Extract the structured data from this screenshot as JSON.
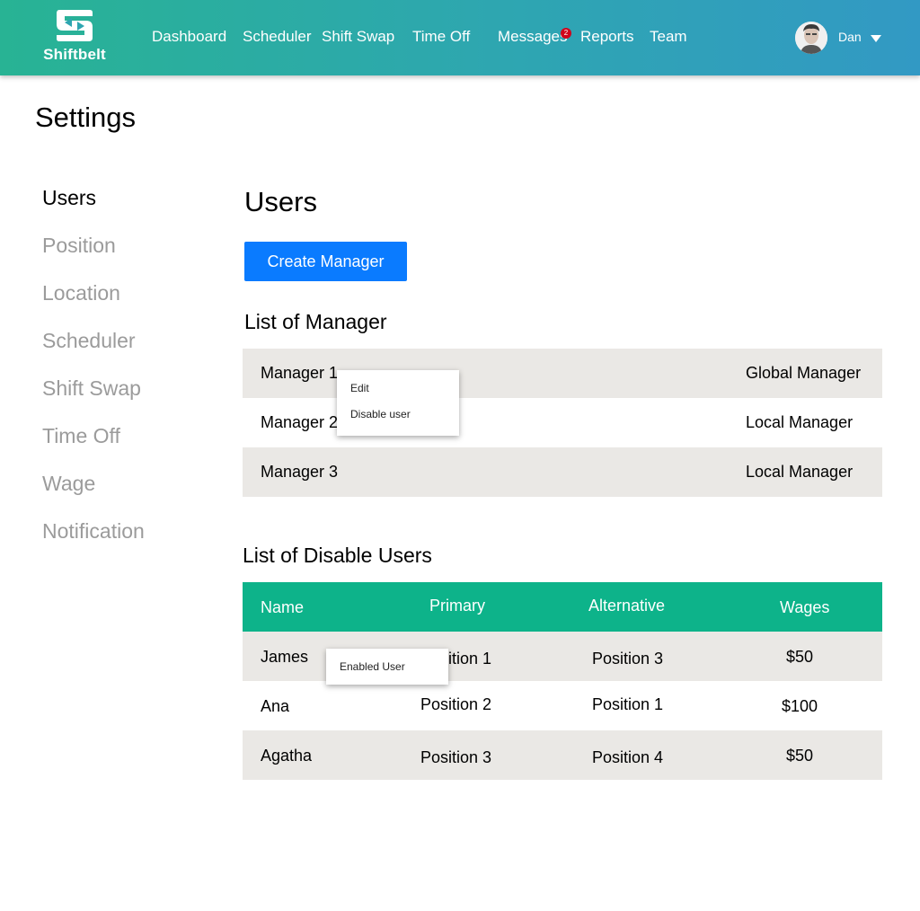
{
  "brand": {
    "name": "Shiftbelt",
    "color": "#ffffff"
  },
  "nav": {
    "items": [
      "Dashboard",
      "Scheduler",
      "Shift Swap",
      "Time Off",
      "Messages",
      "Reports",
      "Team"
    ],
    "messages_badge": "2"
  },
  "user": {
    "name": "Dan"
  },
  "page": {
    "title": "Settings"
  },
  "sidebar": {
    "items": [
      "Users",
      "Position",
      "Location",
      "Scheduler",
      "Shift Swap",
      "Time Off",
      "Wage",
      "Notification"
    ],
    "active": "Users"
  },
  "main": {
    "title": "Users",
    "create_button": "Create Manager",
    "managers_heading": "List of Manager",
    "managers": [
      {
        "name": "Manager 1",
        "role": "Global Manager"
      },
      {
        "name": "Manager 2",
        "role": "Local Manager"
      },
      {
        "name": "Manager 3",
        "role": "Local Manager"
      }
    ],
    "manager_menu": {
      "items": [
        "Edit",
        "Disable user"
      ]
    },
    "disabled_heading": "List of Disable Users",
    "disabled_columns": [
      "Name",
      "Primary",
      "Alternative",
      "Wages"
    ],
    "disabled_users": [
      {
        "name": "James",
        "primary": "Position 1",
        "alternative": "Position 3",
        "wages": "$50"
      },
      {
        "name": "Ana",
        "primary": "Position 2",
        "alternative": "Position 1",
        "wages": "$100"
      },
      {
        "name": "Agatha",
        "primary": "Position 3",
        "alternative": "Position 4",
        "wages": "$50"
      }
    ],
    "disabled_menu": {
      "items": [
        "Enabled User"
      ]
    }
  },
  "colors": {
    "accent": "#0a7bff",
    "table_header": "#0db38a",
    "row_stripe": "#eae8e5",
    "inactive_text": "#9b9b9b",
    "badge": "#d0021b"
  }
}
